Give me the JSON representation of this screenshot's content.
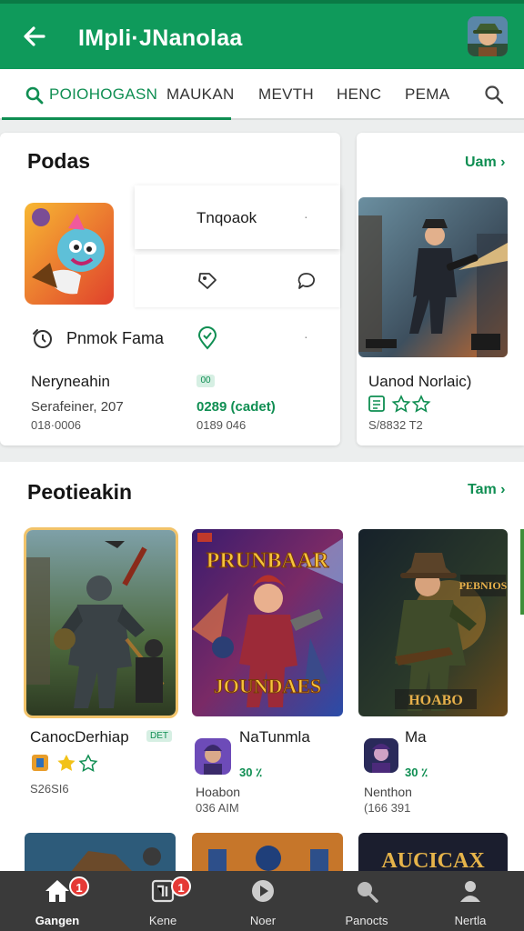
{
  "app": {
    "title": "IMpli·JNanolaa"
  },
  "tabs": [
    {
      "label": "POIOHOGASN"
    },
    {
      "label": "MAUKAN"
    },
    {
      "label": "MEVTH"
    },
    {
      "label": "HENC"
    },
    {
      "label": "PEMA"
    }
  ],
  "section1": {
    "title": "Podas",
    "see_all": "Uam ›",
    "menu_item_1": "Tnqoaok",
    "menu_item_2": "Pnmok Fama",
    "game1": {
      "name": "Neryneahin",
      "line1": "Serafeiner, 207",
      "line2": "018·0006"
    },
    "game2": {
      "badge": "00",
      "line1": "0289 (cadet)",
      "line2": "0189 046"
    },
    "game3": {
      "name": "Uanod Norlaic)",
      "line1": "S/8832 T2"
    }
  },
  "section2": {
    "title": "Peotieakin",
    "see_all": "Tam ›",
    "games": [
      {
        "name": "CanocDerhiap",
        "tag": "DET",
        "line1": "S26SI6"
      },
      {
        "name": "NaTunmla",
        "price": "30 ٪",
        "line1": "Hoabon",
        "line2": "036 AIM"
      },
      {
        "name": "Ma",
        "price": "30 ٪",
        "line1": "Nenthon",
        "line2": "(166 391"
      }
    ],
    "game_art": {
      "g2_top": "PRUNBAAR",
      "g2_bottom": "JOUNDAES",
      "g3_text": "HOABO",
      "g3_side": "PEBNIOS",
      "row3_c": "AUCICAX"
    }
  },
  "nav": {
    "items": [
      {
        "label": "Gangen",
        "badge": "1"
      },
      {
        "label": "Kene",
        "badge": "1"
      },
      {
        "label": "Noer"
      },
      {
        "label": "Panocts"
      },
      {
        "label": "Nertla"
      }
    ]
  },
  "colors": {
    "brand": "#0f9a5b",
    "accent": "#0f8e52",
    "nav_bg": "#3a3a3a",
    "badge": "#e53935"
  }
}
